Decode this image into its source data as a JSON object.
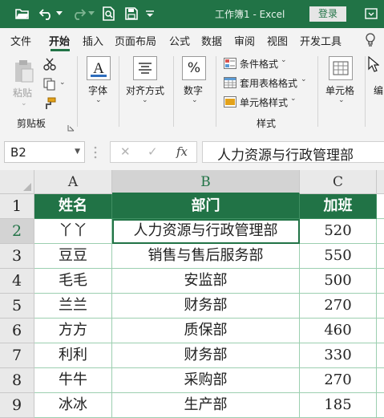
{
  "titlebar": {
    "title": "工作簿1  -  Excel",
    "login_label": "登录",
    "icons": [
      "folder-open-icon",
      "undo-icon",
      "undo-dropdown-icon",
      "redo-icon",
      "redo-dropdown-icon",
      "print-preview-icon",
      "save-icon",
      "customize-dropdown-icon",
      "ribbon-display-icon"
    ]
  },
  "menu": {
    "items": [
      "文件",
      "开始",
      "插入",
      "页面布局",
      "公式",
      "数据",
      "审阅",
      "视图",
      "开发工具"
    ],
    "active": "开始",
    "help_icon": "lightbulb-icon"
  },
  "ribbon": {
    "clipboard": {
      "paste_label": "粘贴",
      "group_label": "剪贴板"
    },
    "font": {
      "label": "字体",
      "icon_letter": "A"
    },
    "alignment": {
      "label": "对齐方式"
    },
    "number": {
      "label": "数字",
      "icon_symbol": "%"
    },
    "styles": {
      "conditional_format": "条件格式",
      "table_format": "套用表格格式",
      "cell_styles": "单元格样式",
      "group_label": "样式"
    },
    "cells": {
      "label": "单元格"
    },
    "editing": {
      "label": "编"
    }
  },
  "formula_bar": {
    "name_box": "B2",
    "cancel_symbol": "✕",
    "enter_symbol": "✓",
    "fx_symbol": "fx",
    "content": "人力资源与行政管理部"
  },
  "sheet": {
    "columns": [
      "A",
      "B",
      "C"
    ],
    "selected_cell": "B2",
    "rows": [
      {
        "num": "1",
        "cells": [
          "姓名",
          "部门",
          "加班"
        ]
      },
      {
        "num": "2",
        "cells": [
          "丫丫",
          "人力资源与行政管理部",
          "520"
        ]
      },
      {
        "num": "3",
        "cells": [
          "豆豆",
          "销售与售后服务部",
          "550"
        ]
      },
      {
        "num": "4",
        "cells": [
          "毛毛",
          "安监部",
          "500"
        ]
      },
      {
        "num": "5",
        "cells": [
          "兰兰",
          "财务部",
          "270"
        ]
      },
      {
        "num": "6",
        "cells": [
          "方方",
          "质保部",
          "460"
        ]
      },
      {
        "num": "7",
        "cells": [
          "利利",
          "财务部",
          "330"
        ]
      },
      {
        "num": "8",
        "cells": [
          "牛牛",
          "采购部",
          "270"
        ]
      },
      {
        "num": "9",
        "cells": [
          "冰冰",
          "生产部",
          "185"
        ]
      }
    ]
  },
  "colors": {
    "accent": "#217346",
    "gridline": "#9ccfb0"
  }
}
